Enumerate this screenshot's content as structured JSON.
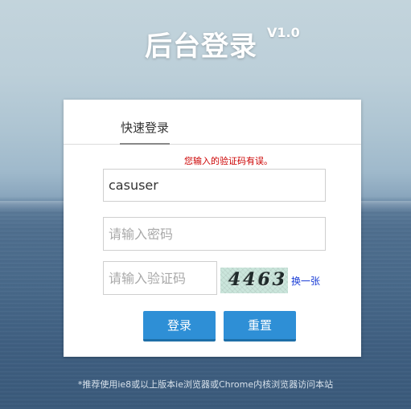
{
  "header": {
    "title": "后台登录",
    "version": "V1.0"
  },
  "login": {
    "tab_label": "快速登录",
    "error_message": "您输入的验证码有误。",
    "username": {
      "value": "casuser",
      "placeholder": ""
    },
    "password": {
      "value": "",
      "placeholder": "请输入密码"
    },
    "captcha": {
      "value": "",
      "placeholder": "请输入验证码",
      "image_text": "4463",
      "refresh_label": "换一张"
    },
    "buttons": {
      "login_label": "登录",
      "reset_label": "重置"
    }
  },
  "footer": {
    "text": "*推荐使用ie8或以上版本ie浏览器或Chrome内核浏览器访问本站"
  },
  "colors": {
    "button": "#2e8fd6",
    "error": "#cc0000",
    "link": "#1a3dd6",
    "captcha_bg": "#cbe6dc"
  }
}
